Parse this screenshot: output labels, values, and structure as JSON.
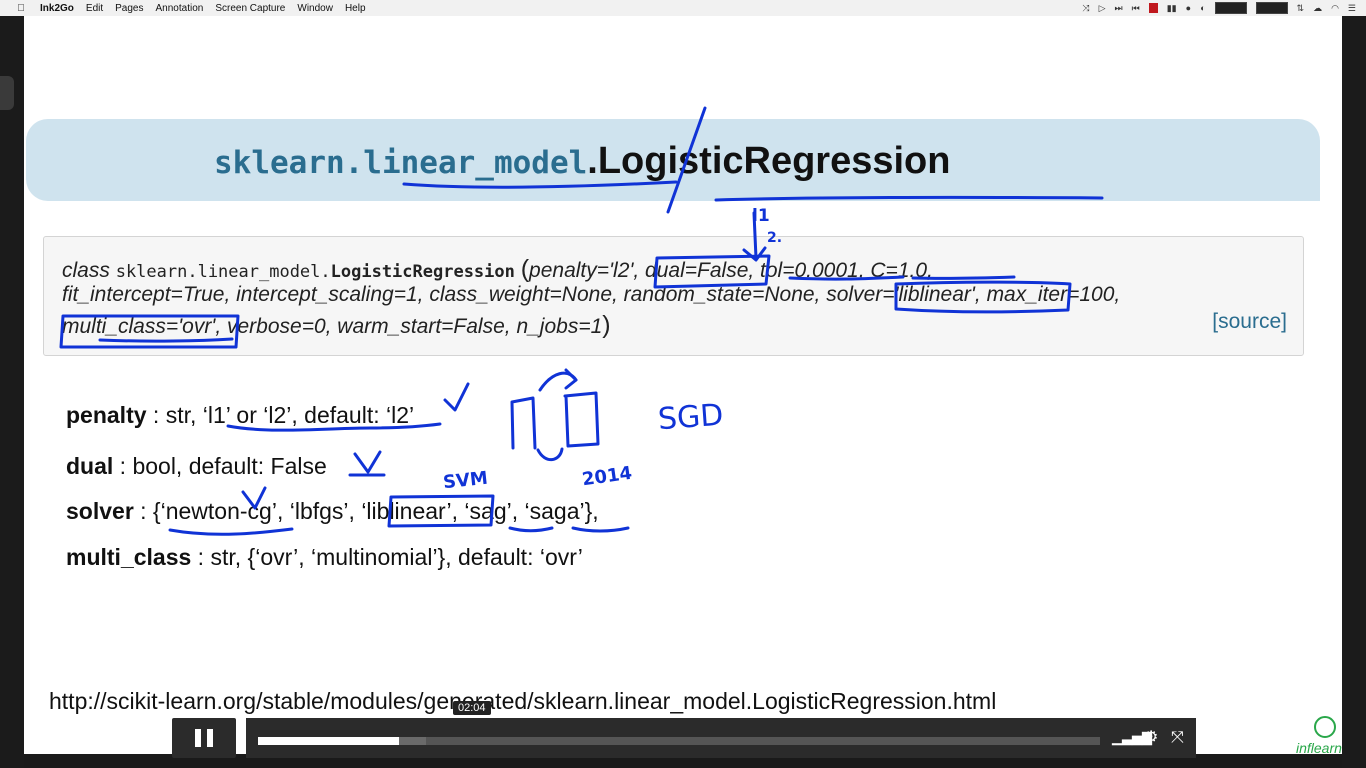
{
  "menubar": {
    "apple": "",
    "app_name": "Ink2Go",
    "items": [
      "Edit",
      "Pages",
      "Annotation",
      "Screen Capture",
      "Window",
      "Help"
    ]
  },
  "slide": {
    "module_text": "sklearn.linear_model",
    "class_text": ".LogisticRegression",
    "signature": {
      "line1_class_kw": "class",
      "line1_module": "sklearn.linear_model.",
      "line1_classname": "LogisticRegression",
      "line1_paren": "(",
      "line1_args": "penalty='l2', dual=False, tol=0.0001, C=1.0,",
      "line2": "fit_intercept=True, intercept_scaling=1, class_weight=None, random_state=None, solver='liblinear', max_iter=100,",
      "line3": "multi_class='ovr', verbose=0, warm_start=False, n_jobs=1",
      "line3_close": ")",
      "source_link": "[source]"
    },
    "params": [
      {
        "name": "penalty",
        "desc": " : str, ‘l1’ or ‘l2’, default: ‘l2’"
      },
      {
        "name": "dual",
        "desc": " : bool, default: False"
      },
      {
        "name": "solver",
        "desc": " : {‘newton-cg’, ‘lbfgs’, ‘liblinear’, ‘sag’, ‘saga’},"
      },
      {
        "name": "multi_class",
        "desc": " : str, {‘ovr’, ‘multinomial’}, default: ‘ovr’"
      }
    ],
    "url": "http://scikit-learn.org/stable/modules/generated/sklearn.linear_model.LogisticRegression.html"
  },
  "annotations": {
    "l1_mark": "l1",
    "l2_mark": "2.",
    "svm_label": "SVM",
    "year_label": "2014",
    "sgd_label": "SGD"
  },
  "player": {
    "time_tooltip": "02:04",
    "progress": 0.167,
    "buffered": 0.2,
    "play_state": "pause-icon",
    "icons": [
      "pause-icon",
      "volume-icon",
      "settings-gear-icon",
      "fullscreen-icon"
    ]
  },
  "brand": {
    "logo_text": "inflearn",
    "accent": "#2aa74a"
  },
  "colors": {
    "ink": "#1033d6",
    "banner": "#cfe3ee",
    "module_blue": "#2a6d8f"
  }
}
